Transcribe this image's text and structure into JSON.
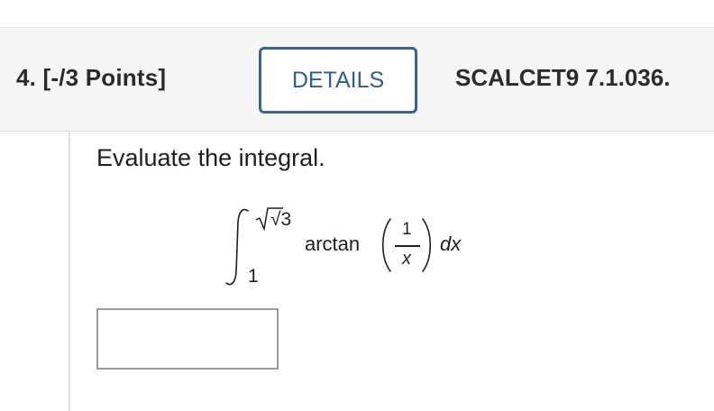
{
  "question": {
    "number_points": "4. [-/3 Points]",
    "details_label": "DETAILS",
    "reference": "SCALCET9 7.1.036."
  },
  "problem": {
    "prompt": "Evaluate the integral.",
    "integral": {
      "upper_limit": "√3",
      "lower_limit": "1",
      "function_name": "arctan",
      "fraction_numerator": "1",
      "fraction_denominator": "x",
      "differential": "dx"
    }
  },
  "answer": {
    "value": "",
    "placeholder": ""
  },
  "colors": {
    "header_background": "#f5f5f5",
    "details_border": "#3a6391",
    "details_text": "#2f5d8e",
    "text": "#2b2b2b"
  }
}
